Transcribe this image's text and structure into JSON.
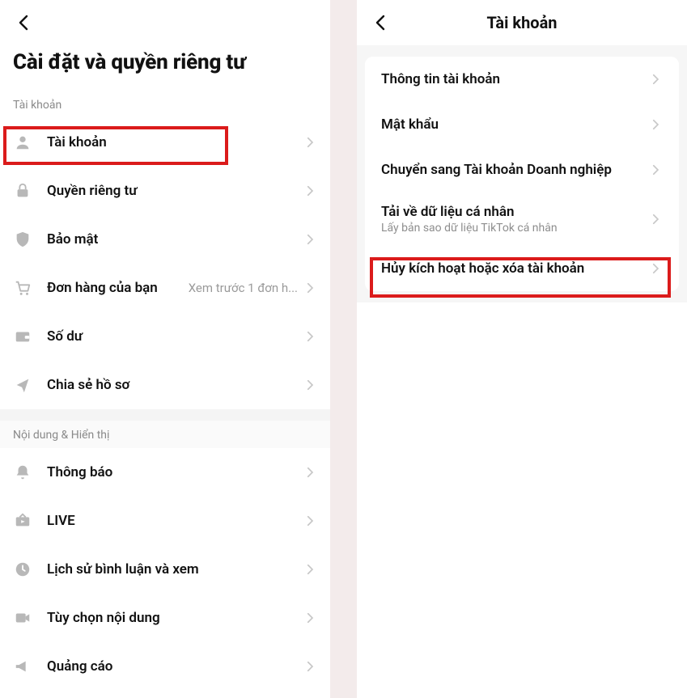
{
  "left": {
    "title": "Cài đặt và quyền riêng tư",
    "section_account": "Tài khoản",
    "section_content": "Nội dung & Hiển thị",
    "rows": {
      "account": "Tài khoản",
      "privacy": "Quyền riêng tư",
      "security": "Bảo mật",
      "orders": "Đơn hàng của bạn",
      "orders_hint": "Xem trước 1 đơn h...",
      "balance": "Số dư",
      "share": "Chia sẻ hồ sơ",
      "notifications": "Thông báo",
      "live": "LIVE",
      "history": "Lịch sử bình luận và xem",
      "content_pref": "Tùy chọn nội dung",
      "ads": "Quảng cáo"
    }
  },
  "right": {
    "title": "Tài khoản",
    "rows": {
      "info": "Thông tin tài khoản",
      "password": "Mật khẩu",
      "switch_biz": "Chuyển sang Tài khoản Doanh nghiệp",
      "download": "Tải về dữ liệu cá nhân",
      "download_sub": "Lấy bản sao dữ liệu TikTok cá nhân",
      "deactivate": "Hủy kích hoạt hoặc xóa tài khoản"
    }
  }
}
